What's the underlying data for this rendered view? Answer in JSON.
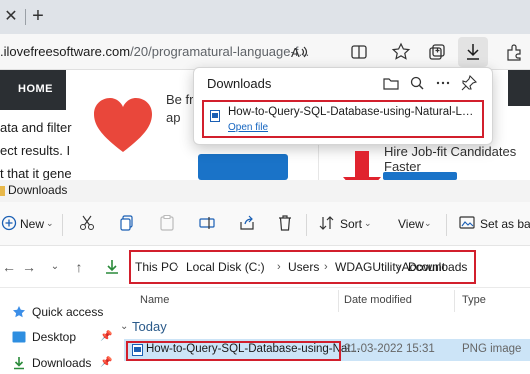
{
  "browser": {
    "tab": {
      "close_glyph": "✕",
      "new_tab_glyph": "+"
    },
    "address": {
      "domain": ".ilovefreesoftware.com",
      "path": "/20/programatural-language-f..."
    },
    "toolbar_icons": [
      "read-aloud-icon",
      "split-screen-icon",
      "favorites-icon",
      "collections-icon",
      "downloads-icon",
      "extensions-icon"
    ],
    "site": {
      "nav_home": "HOME",
      "body_lines": [
        "ata and filter",
        "ect results. I",
        "t that it gene"
      ],
      "promo_line1": "Be fr",
      "promo_line2": "ap",
      "sidebar_ad": "Hire Job-fit Candidates Faster",
      "heart_color": "#e9473b",
      "button_color": "#1a73c8"
    },
    "downloads_flyout": {
      "title": "Downloads",
      "icons": [
        "folder-icon",
        "search-icon",
        "more-icon",
        "pin-icon"
      ],
      "item": {
        "filename": "How-to-Query-SQL-Database-using-Natural-Language...",
        "action": "Open file"
      }
    }
  },
  "explorer": {
    "window_title": "Downloads",
    "commands": {
      "new": "New",
      "sort": "Sort",
      "view": "View",
      "set_as_background": "Set as back"
    },
    "breadcrumb": [
      "This PC",
      "Local Disk (C:)",
      "Users",
      "WDAGUtilityAccount",
      "Downloads"
    ],
    "nav_pane": [
      {
        "label": "Quick access",
        "icon": "star-icon",
        "pinned": false
      },
      {
        "label": "Desktop",
        "icon": "desktop-icon",
        "pinned": true
      },
      {
        "label": "Downloads",
        "icon": "download-icon",
        "pinned": true
      }
    ],
    "columns": {
      "name": "Name",
      "date": "Date modified",
      "type": "Type"
    },
    "group": "Today",
    "files": [
      {
        "name": "How-to-Query-SQL-Database-using-Nat...",
        "date": "21-03-2022 15:31",
        "type": "PNG image",
        "selected": true
      }
    ]
  },
  "colors": {
    "highlight_red": "#d21f2c",
    "selection_blue": "#cce4f7",
    "link_blue": "#1565c0"
  }
}
